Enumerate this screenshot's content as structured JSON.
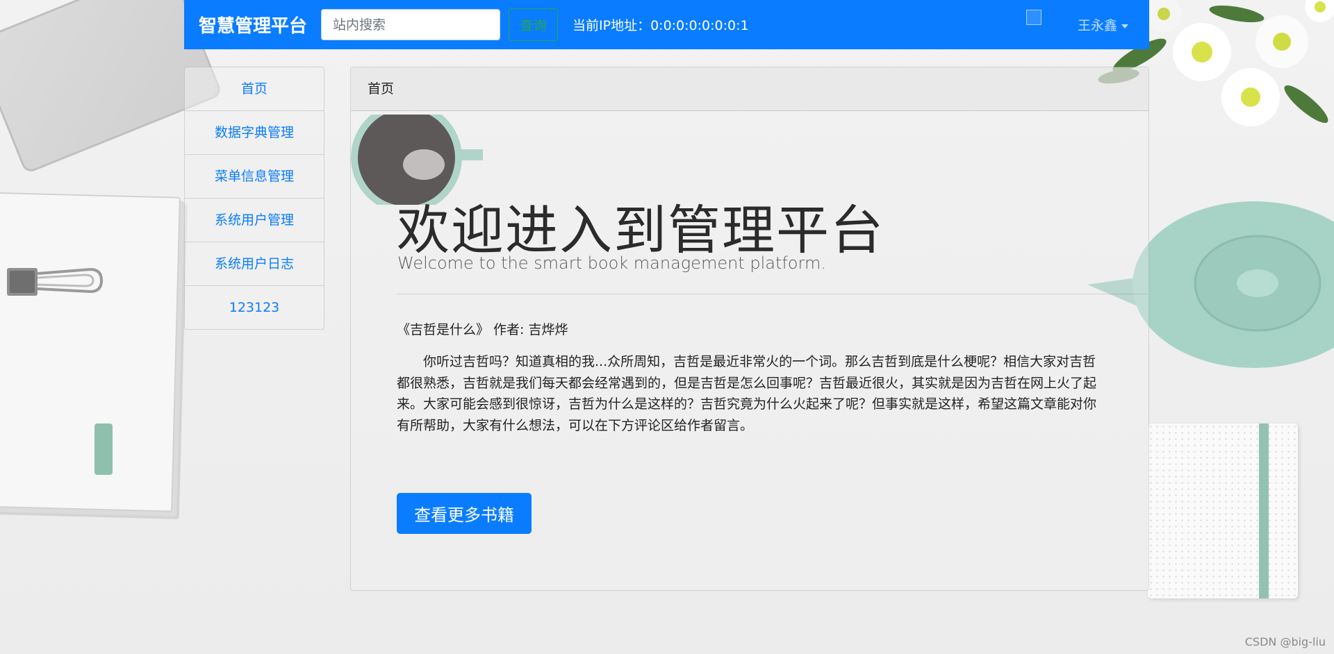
{
  "navbar": {
    "brand": "智慧管理平台",
    "search_placeholder": "站内搜索",
    "search_button": "查询",
    "ip_text": "当前IP地址：0:0:0:0:0:0:0:1",
    "user_name": "王永鑫",
    "accent_color": "#0a7cff",
    "search_button_color": "#28a745"
  },
  "sidebar": {
    "items": [
      {
        "label": "首页"
      },
      {
        "label": "数据字典管理"
      },
      {
        "label": "菜单信息管理"
      },
      {
        "label": "系统用户管理"
      },
      {
        "label": "系统用户日志"
      },
      {
        "label": "123123"
      }
    ]
  },
  "main": {
    "header": "首页",
    "title": "欢迎进入到管理平台",
    "lead": "Welcome to the smart book management platform.",
    "book_line": "《吉哲是什么》 作者: 吉烨烨",
    "paragraph": "你听过吉哲吗？知道真相的我...众所周知，吉哲是最近非常火的一个词。那么吉哲到底是什么梗呢？相信大家对吉哲都很熟悉，吉哲就是我们每天都会经常遇到的，但是吉哲是怎么回事呢？吉哲最近很火，其实就是因为吉哲在网上火了起来。大家可能会感到很惊讶，吉哲为什么是这样的？吉哲究竟为什么火起来了呢？但事实就是这样，希望这篇文章能对你有所帮助，大家有什么想法，可以在下方评论区给作者留言。",
    "more_button": "查看更多书籍"
  },
  "watermark": "CSDN @big-liu"
}
